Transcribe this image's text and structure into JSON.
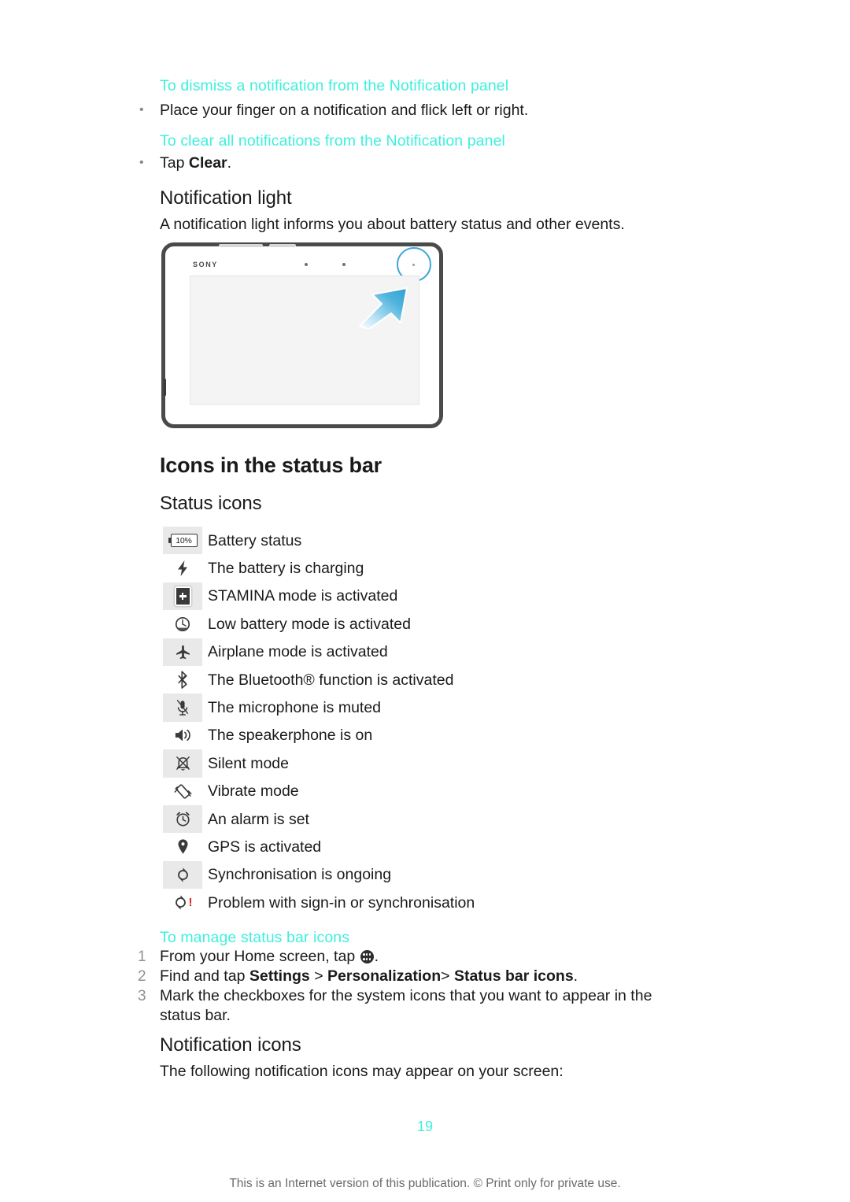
{
  "document": {
    "page_number": "19",
    "footer_note": "This is an Internet version of this publication. © Print only for private use."
  },
  "procedures": [
    {
      "heading": "To dismiss a notification from the Notification panel",
      "bullet": "Place your finger on a notification and flick left or right.",
      "bullet_marker": "•"
    },
    {
      "heading": "To clear all notifications from the Notification panel",
      "bullet_prefix": "Tap ",
      "bullet_bold": "Clear",
      "bullet_suffix": ".",
      "bullet_marker": "•"
    }
  ],
  "notification_light": {
    "title": "Notification light",
    "body": "A notification light informs you about battery status and other events.",
    "illustration": {
      "brand": "SONY",
      "callout": "notification-light-indicator"
    }
  },
  "status_bar_section": {
    "title": "Icons in the status bar",
    "subtitle": "Status icons",
    "rows": [
      {
        "icon": "battery-status-icon",
        "icon_text": "10%",
        "label": "Battery status"
      },
      {
        "icon": "battery-charging-icon",
        "glyph": "⚡",
        "label": "The battery is charging"
      },
      {
        "icon": "stamina-mode-icon",
        "label": "STAMINA mode is activated"
      },
      {
        "icon": "low-battery-mode-icon",
        "label": "Low battery mode is activated"
      },
      {
        "icon": "airplane-mode-icon",
        "label": "Airplane mode is activated"
      },
      {
        "icon": "bluetooth-icon",
        "label": "The Bluetooth® function is activated"
      },
      {
        "icon": "microphone-muted-icon",
        "label": "The microphone is muted"
      },
      {
        "icon": "speakerphone-icon",
        "label": "The speakerphone is on"
      },
      {
        "icon": "silent-mode-icon",
        "label": "Silent mode"
      },
      {
        "icon": "vibrate-mode-icon",
        "label": "Vibrate mode"
      },
      {
        "icon": "alarm-icon",
        "label": "An alarm is set"
      },
      {
        "icon": "gps-icon",
        "label": "GPS is activated"
      },
      {
        "icon": "sync-ongoing-icon",
        "label": "Synchronisation is ongoing"
      },
      {
        "icon": "sync-problem-icon",
        "badge": "!",
        "label": "Problem with sign-in or synchronisation"
      }
    ]
  },
  "manage_procedure": {
    "heading": "To manage status bar icons",
    "steps": [
      {
        "num": "1",
        "text_before": "From your Home screen, tap ",
        "icon": "app-drawer-icon",
        "text_after": "."
      },
      {
        "num": "2",
        "text_before": "Find and tap ",
        "bold_1": "Settings",
        "sep_1": " > ",
        "bold_2": "Personalization",
        "sep_2": "> ",
        "bold_3": "Status bar icons",
        "text_after": "."
      },
      {
        "num": "3",
        "text_before": "Mark the checkboxes for the system icons that you want to appear in the status bar."
      }
    ]
  },
  "notification_icons_section": {
    "title": "Notification icons",
    "body": "The following notification icons may appear on your screen:"
  },
  "colors": {
    "accent": "#3ff0dd",
    "text": "#1a1a1a",
    "muted": "#6b6b6b",
    "icon_cell_shade": "#e9e9e9",
    "alert_red": "#e02020",
    "callout_blue": "#3aa6d8"
  }
}
